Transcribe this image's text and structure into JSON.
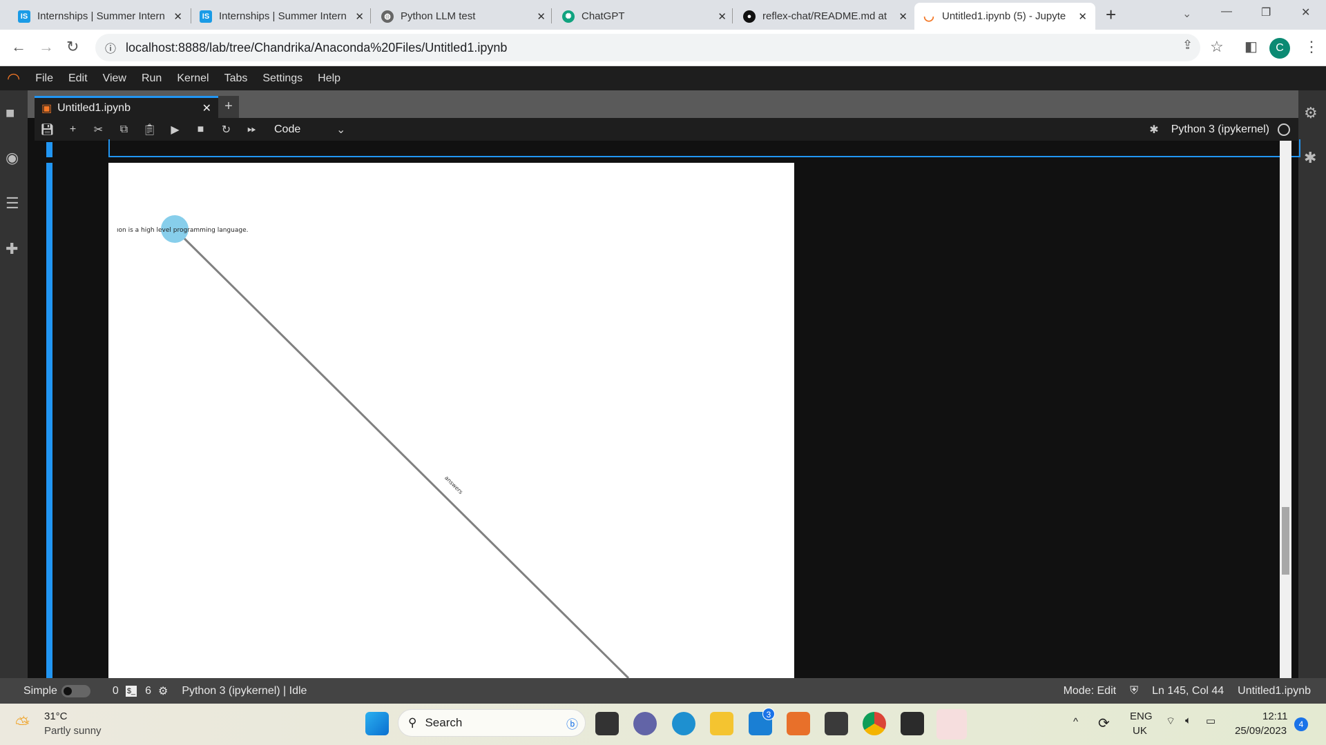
{
  "browser": {
    "tabs": [
      {
        "title": "Internships | Summer Intern",
        "icon": "IS",
        "color": "#1a9be6"
      },
      {
        "title": "Internships | Summer Intern",
        "icon": "IS",
        "color": "#1a9be6"
      },
      {
        "title": "Python LLM test",
        "icon": "globe",
        "color": "#555"
      },
      {
        "title": "ChatGPT",
        "icon": "openai",
        "color": "#10a37f"
      },
      {
        "title": "reflex-chat/README.md at",
        "icon": "github",
        "color": "#111"
      },
      {
        "title": "Untitled1.ipynb (5) - Jupyte",
        "icon": "jupyter",
        "color": "#f37726"
      }
    ],
    "new_tab": "+",
    "url": "localhost:8888/lab/tree/Chandrika/Anaconda%20Files/Untitled1.ipynb",
    "profile": "C"
  },
  "menu": [
    "File",
    "Edit",
    "View",
    "Run",
    "Kernel",
    "Tabs",
    "Settings",
    "Help"
  ],
  "notebook": {
    "tab": "Untitled1.ipynb",
    "cell_type": "Code",
    "kernel": "Python 3 (ipykernel)"
  },
  "graph": {
    "node_label": "ıon is a high level programming language.",
    "edge_label": "answers",
    "node_color": "#87ceeb"
  },
  "status": {
    "mode_label": "Simple",
    "count0": "0",
    "count6": "6",
    "kernel_status": "Python 3 (ipykernel) | Idle",
    "mode": "Mode: Edit",
    "position": "Ln 145, Col 44",
    "file": "Untitled1.ipynb"
  },
  "taskbar": {
    "temp": "31°C",
    "weather": "Partly sunny",
    "search": "Search",
    "mail_badge": "3",
    "lang1": "ENG",
    "lang2": "UK",
    "time": "12:11",
    "date": "25/09/2023",
    "notif": "4"
  }
}
